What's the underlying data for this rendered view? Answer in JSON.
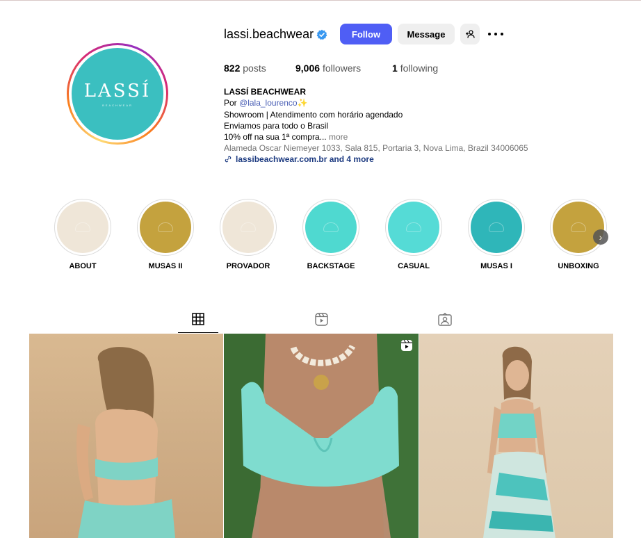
{
  "profile": {
    "username": "lassi.beachwear",
    "verified": true,
    "avatar_logo": "LASSÍ",
    "avatar_sub": "BEACHWEAR",
    "brand_color": "#3bbfc0",
    "accent_color": "#4f5ef5"
  },
  "actions": {
    "follow_label": "Follow",
    "message_label": "Message",
    "suggest_icon": "person-add-icon",
    "more_icon": "more-options-icon"
  },
  "stats": {
    "posts_count": "822",
    "posts_label": "posts",
    "followers_count": "9,006",
    "followers_label": "followers",
    "following_count": "1",
    "following_label": "following"
  },
  "bio": {
    "name": "LASSÍ BEACHWEAR",
    "line1_prefix": "Por ",
    "line1_mention": "@lala_lourenco",
    "line1_emoji": "✨",
    "line2": "Showroom | Atendimento com horário agendado",
    "line3": "Enviamos para todo o Brasil",
    "line4": "10% off na sua 1ª compra...",
    "line4_more": " more",
    "address": "Alameda Oscar Niemeyer 1033, Sala 815, Portaria 3, Nova Lima, Brazil 34006065",
    "website": "lassibeachwear.com.br and 4 more"
  },
  "highlights": [
    {
      "label": "ABOUT",
      "color": "#efe6d8"
    },
    {
      "label": "MUSAS II",
      "color": "#c4a23e"
    },
    {
      "label": "PROVADOR",
      "color": "#efe6d8"
    },
    {
      "label": "BACKSTAGE",
      "color": "#4fd9d0"
    },
    {
      "label": "CASUAL",
      "color": "#55dbd6"
    },
    {
      "label": "MUSAS I",
      "color": "#2fb6b9"
    },
    {
      "label": "UNBOXING",
      "color": "#c4a23e"
    }
  ],
  "tabs": [
    {
      "name": "posts",
      "icon": "grid-icon",
      "active": true
    },
    {
      "name": "reels",
      "icon": "reels-icon",
      "active": false
    },
    {
      "name": "tagged",
      "icon": "tagged-icon",
      "active": false
    }
  ],
  "posts": [
    {
      "type": "photo"
    },
    {
      "type": "reel",
      "badge_icon": "reels-icon"
    },
    {
      "type": "photo"
    }
  ]
}
